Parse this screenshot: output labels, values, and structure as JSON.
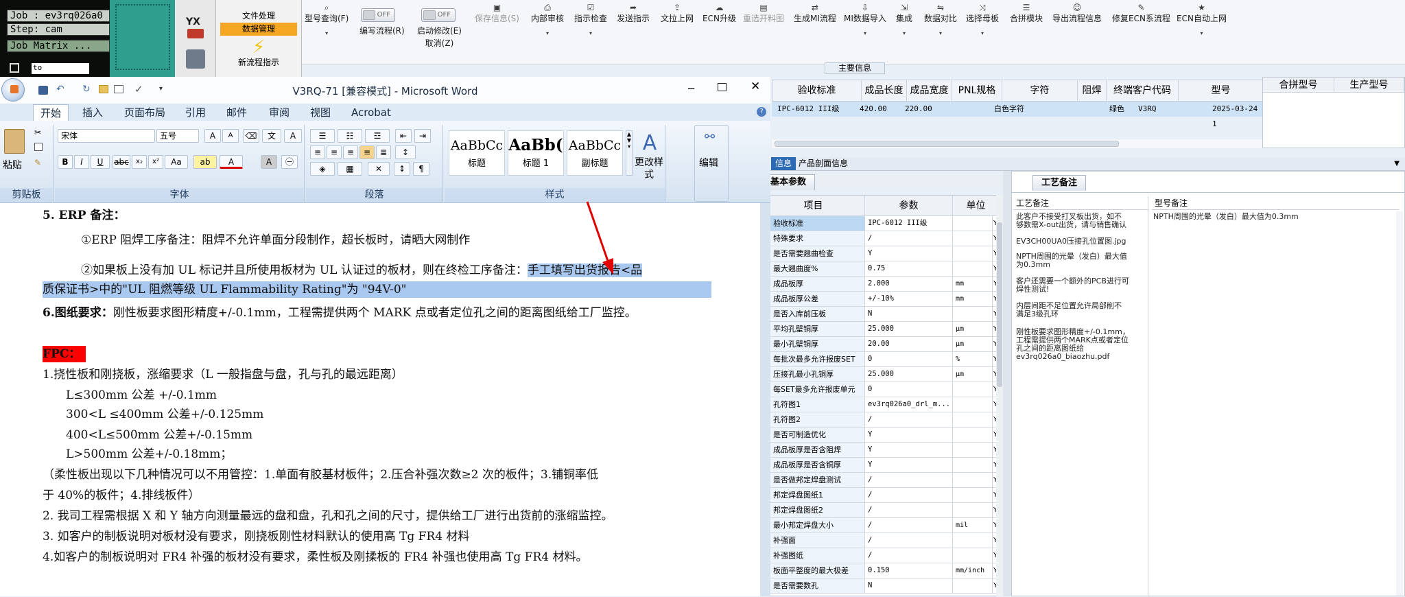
{
  "cam": {
    "job": "Job : ev3rq026a0",
    "step": "Step: cam",
    "matrix": "Job Matrix ...",
    "to": "to"
  },
  "side_app": {
    "yx_label": "YX",
    "file_proc": "文件处理",
    "data_mgmt": "数据管理",
    "new_flow": "新流程指示"
  },
  "toolbar": {
    "items": [
      {
        "label": "型号查询(F)",
        "icon": "search-icon",
        "dropdown": true
      },
      {
        "label": "编写流程(R)",
        "toggle": "OFF"
      },
      {
        "label": "启动修改(E)",
        "toggle": "OFF",
        "sub": "取消(Z)"
      },
      {
        "label": "保存信息(S)",
        "disabled": true
      },
      {
        "label": "内部审核",
        "icon": "print-icon",
        "dropdown": true
      },
      {
        "label": "指示检查",
        "icon": "check-icon",
        "dropdown": true
      },
      {
        "label": "发送指示",
        "icon": "send-icon"
      },
      {
        "label": "文拉上网",
        "icon": "upload-icon"
      },
      {
        "label": "ECN升级",
        "icon": "cloud-icon"
      },
      {
        "label": "重选开料图",
        "disabled": true
      },
      {
        "label": "生成MI流程",
        "icon": "flow-icon"
      },
      {
        "label": "MI数据导入",
        "icon": "import-icon",
        "dropdown": true
      },
      {
        "label": "集成",
        "icon": "integrate-icon",
        "dropdown": true
      },
      {
        "label": "数据对比",
        "icon": "compare-icon",
        "dropdown": true
      },
      {
        "label": "选择母板",
        "icon": "select-icon",
        "dropdown": true
      },
      {
        "label": "合拼模块",
        "icon": "merge-icon"
      },
      {
        "label": "导出流程信息",
        "icon": "export-icon"
      },
      {
        "label": "修复ECN系流程",
        "icon": "wrench-icon"
      },
      {
        "label": "ECN自动上网",
        "icon": "star-icon",
        "dropdown": true
      }
    ]
  },
  "main_info_label": "主要信息",
  "grid": {
    "headers": [
      "验收标准",
      "成品长度",
      "成品宽度",
      "PNL规格",
      "字符",
      "阻焊",
      "终端客户代码",
      "型号"
    ],
    "row": [
      "IPC-6012 III级",
      "420.00",
      "220.00",
      "",
      "白色字符",
      "绿色",
      "V3RQ",
      "2025-03-24 1"
    ]
  },
  "right_grid": {
    "headers": [
      "合拼型号",
      "生产型号"
    ]
  },
  "info_tabs": {
    "info": "信息",
    "product": "产品剖面信息"
  },
  "basic_params_tab": "基本参数",
  "craft_tab": "工艺备注",
  "param_table": {
    "headers": [
      "项目",
      "参数",
      "单位"
    ],
    "rows": [
      {
        "name": "验收标准",
        "value": "IPC-6012 III级",
        "unit": "",
        "flag": "Y"
      },
      {
        "name": "特殊要求",
        "value": "/",
        "unit": "",
        "flag": "Y"
      },
      {
        "name": "是否需要翘曲检查",
        "value": "Y",
        "unit": "",
        "flag": "Y"
      },
      {
        "name": "最大翘曲度%",
        "value": "0.75",
        "unit": "",
        "flag": "Y"
      },
      {
        "name": "成品板厚",
        "value": "2.000",
        "unit": "mm",
        "flag": "Y"
      },
      {
        "name": "成品板厚公差",
        "value": "+/-10%",
        "unit": "mm",
        "flag": "Y"
      },
      {
        "name": "是否入库前压板",
        "value": "N",
        "unit": "",
        "flag": "Y"
      },
      {
        "name": "平均孔壁铜厚",
        "value": "25.000",
        "unit": "μm",
        "flag": "Y"
      },
      {
        "name": "最小孔壁铜厚",
        "value": "20.00",
        "unit": "μm",
        "flag": "Y"
      },
      {
        "name": "每批次最多允许报废SET",
        "value": "0",
        "unit": "%",
        "flag": "Y"
      },
      {
        "name": "压接孔最小孔铜厚",
        "value": "25.000",
        "unit": "μm",
        "flag": "Y"
      },
      {
        "name": "每SET最多允许报废单元",
        "value": "0",
        "unit": "",
        "flag": "Y"
      },
      {
        "name": "孔符图1",
        "value": "ev3rq026a0_drl_m...",
        "unit": "",
        "flag": "Y"
      },
      {
        "name": "孔符图2",
        "value": "/",
        "unit": "",
        "flag": "Y"
      },
      {
        "name": "是否可制造优化",
        "value": "Y",
        "unit": "",
        "flag": "Y"
      },
      {
        "name": "成品板厚是否含阻焊",
        "value": "Y",
        "unit": "",
        "flag": "Y"
      },
      {
        "name": "成品板厚是否含铜厚",
        "value": "Y",
        "unit": "",
        "flag": "Y"
      },
      {
        "name": "是否做邦定焊盘测试",
        "value": "/",
        "unit": "",
        "flag": "Y"
      },
      {
        "name": "邦定焊盘图纸1",
        "value": "/",
        "unit": "",
        "flag": "Y"
      },
      {
        "name": "邦定焊盘图纸2",
        "value": "/",
        "unit": "",
        "flag": "Y"
      },
      {
        "name": "最小邦定焊盘大小",
        "value": "/",
        "unit": "mil",
        "flag": "Y"
      },
      {
        "name": "补强面",
        "value": "/",
        "unit": "",
        "flag": "Y"
      },
      {
        "name": "补强图纸",
        "value": "/",
        "unit": "",
        "flag": "Y"
      },
      {
        "name": "板面平整度的最大极差",
        "value": "0.150",
        "unit": "mm/inch",
        "flag": "Y"
      },
      {
        "name": "是否需要数孔",
        "value": "N",
        "unit": "",
        "flag": "Y"
      }
    ]
  },
  "craft": {
    "col1_header": "工艺备注",
    "col2_header": "型号备注",
    "notes": [
      "此客户不接受打叉板出货，如不\n够数需X-out出货，请与销售确认",
      "EV3CH00UA0压接孔位置图.jpg",
      "NPTH周围的光晕（发白）最大值\n为0.3mm",
      "客户还需要一个额外的PCB进行可\n焊性测试!",
      "内层间距不足位置允许局部削不\n满足3级孔环",
      "刚性板要求图形精度+/-0.1mm，\n工程需提供两个MARK点或者定位\n孔之间的距离图纸给\nev3rq026a0_biaozhu.pdf"
    ],
    "model_note": "NPTH周围的光晕（发白）最大值为0.3mm"
  },
  "word": {
    "title": "V3RQ-71 [兼容模式] - Microsoft Word",
    "tabs": [
      "开始",
      "插入",
      "页面布局",
      "引用",
      "邮件",
      "审阅",
      "视图",
      "Acrobat"
    ],
    "font_name": "宋体",
    "font_size": "五号",
    "groups": [
      "剪贴板",
      "字体",
      "段落",
      "样式",
      "编辑"
    ],
    "paste": "粘贴",
    "styles": [
      {
        "preview": "AaBbCc",
        "name": "标题"
      },
      {
        "preview": "AaBb(",
        "name": "标题 1"
      },
      {
        "preview": "AaBbCc",
        "name": "副标题"
      }
    ],
    "change_style": "更改样式",
    "edit": "编辑"
  },
  "doc": {
    "l1": "5.  ERP 备注：",
    "l2": "①ERP 阻焊工序备注：阻焊不允许单面分段制作，超长板时，请晒大网制作",
    "l3a": "②如果板上没有加 UL 标记并且所使用板材为 UL 认证过的板材，则在终检工序备注：",
    "l3b": "手工填写出货报告<品",
    "l4": "质保证书>中的\"UL 阻燃等级 UL Flammability Rating\"为 \"94V-0\"",
    "l5a": "6.图纸要求：",
    "l5b": "刚性板要求图形精度+/-0.1mm，工程需提供两个 MARK 点或者定位孔之间的距离图纸给工厂监控。",
    "fpc": "FPC：",
    "l7": "1.挠性板和刚挠板，涨缩要求（L 一般指盘与盘，孔与孔的最远距离）",
    "l8": "L≤300mm 公差 +/-0.1mm",
    "l9": "300<L ≤400mm 公差+/-0.125mm",
    "l10": "400<L≤500mm 公差+/-0.15mm",
    "l11": "L>500mm 公差+/-0.18mm；",
    "l12": "（柔性板出现以下几种情况可以不用管控：1.单面有胶基材板件；2.压合补强次数≥2  次的板件；3.铺铜率低",
    "l13": "于 40%的板件；4.排线板件）",
    "l14": "2.    我司工程需根据 X 和 Y 轴方向测量最远的盘和盘，孔和孔之间的尺寸，提供给工厂进行出货前的涨缩监控。",
    "l15": "3. 如客户的制板说明对板材没有要求，刚挠板刚性材料默认的使用高 Tg FR4 材料",
    "l16": "4.如客户的制板说明对 FR4 补强的板材没有要求，柔性板及刚揉板的 FR4 补强也使用高 Tg FR4 材料。"
  },
  "colors": {
    "accent": "#2b579a",
    "highlight": "#a9c8ef",
    "fpc_bg": "#ff0000",
    "arrow": "#e00000",
    "selected_row": "#cfe3f7"
  }
}
